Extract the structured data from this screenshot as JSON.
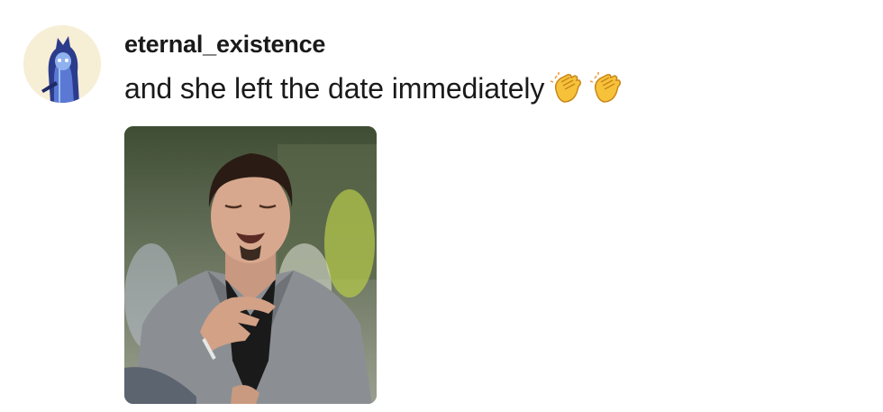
{
  "comment": {
    "username": "eternal_existence",
    "message": "and she left the date immediately",
    "emojis": [
      "clapping-hands-emoji",
      "clapping-hands-emoji"
    ],
    "image": {
      "description_icon": "meme-photo"
    }
  },
  "colors": {
    "text": "#1a1a1a",
    "background": "#ffffff",
    "avatar_bg": "#f6ecd2",
    "emoji_yellow": "#f6c23a"
  }
}
